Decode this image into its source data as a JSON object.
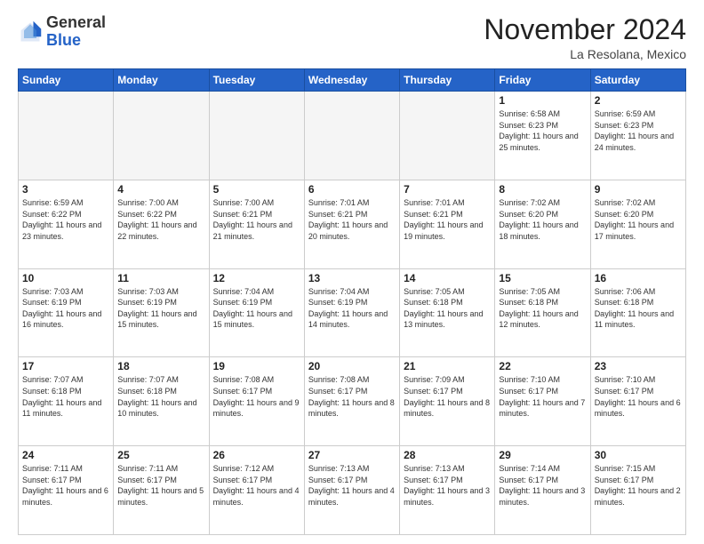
{
  "header": {
    "logo_general": "General",
    "logo_blue": "Blue",
    "month_title": "November 2024",
    "location": "La Resolana, Mexico"
  },
  "days_of_week": [
    "Sunday",
    "Monday",
    "Tuesday",
    "Wednesday",
    "Thursday",
    "Friday",
    "Saturday"
  ],
  "weeks": [
    [
      {
        "day": "",
        "info": ""
      },
      {
        "day": "",
        "info": ""
      },
      {
        "day": "",
        "info": ""
      },
      {
        "day": "",
        "info": ""
      },
      {
        "day": "",
        "info": ""
      },
      {
        "day": "1",
        "info": "Sunrise: 6:58 AM\nSunset: 6:23 PM\nDaylight: 11 hours and 25 minutes."
      },
      {
        "day": "2",
        "info": "Sunrise: 6:59 AM\nSunset: 6:23 PM\nDaylight: 11 hours and 24 minutes."
      }
    ],
    [
      {
        "day": "3",
        "info": "Sunrise: 6:59 AM\nSunset: 6:22 PM\nDaylight: 11 hours and 23 minutes."
      },
      {
        "day": "4",
        "info": "Sunrise: 7:00 AM\nSunset: 6:22 PM\nDaylight: 11 hours and 22 minutes."
      },
      {
        "day": "5",
        "info": "Sunrise: 7:00 AM\nSunset: 6:21 PM\nDaylight: 11 hours and 21 minutes."
      },
      {
        "day": "6",
        "info": "Sunrise: 7:01 AM\nSunset: 6:21 PM\nDaylight: 11 hours and 20 minutes."
      },
      {
        "day": "7",
        "info": "Sunrise: 7:01 AM\nSunset: 6:21 PM\nDaylight: 11 hours and 19 minutes."
      },
      {
        "day": "8",
        "info": "Sunrise: 7:02 AM\nSunset: 6:20 PM\nDaylight: 11 hours and 18 minutes."
      },
      {
        "day": "9",
        "info": "Sunrise: 7:02 AM\nSunset: 6:20 PM\nDaylight: 11 hours and 17 minutes."
      }
    ],
    [
      {
        "day": "10",
        "info": "Sunrise: 7:03 AM\nSunset: 6:19 PM\nDaylight: 11 hours and 16 minutes."
      },
      {
        "day": "11",
        "info": "Sunrise: 7:03 AM\nSunset: 6:19 PM\nDaylight: 11 hours and 15 minutes."
      },
      {
        "day": "12",
        "info": "Sunrise: 7:04 AM\nSunset: 6:19 PM\nDaylight: 11 hours and 15 minutes."
      },
      {
        "day": "13",
        "info": "Sunrise: 7:04 AM\nSunset: 6:19 PM\nDaylight: 11 hours and 14 minutes."
      },
      {
        "day": "14",
        "info": "Sunrise: 7:05 AM\nSunset: 6:18 PM\nDaylight: 11 hours and 13 minutes."
      },
      {
        "day": "15",
        "info": "Sunrise: 7:05 AM\nSunset: 6:18 PM\nDaylight: 11 hours and 12 minutes."
      },
      {
        "day": "16",
        "info": "Sunrise: 7:06 AM\nSunset: 6:18 PM\nDaylight: 11 hours and 11 minutes."
      }
    ],
    [
      {
        "day": "17",
        "info": "Sunrise: 7:07 AM\nSunset: 6:18 PM\nDaylight: 11 hours and 11 minutes."
      },
      {
        "day": "18",
        "info": "Sunrise: 7:07 AM\nSunset: 6:18 PM\nDaylight: 11 hours and 10 minutes."
      },
      {
        "day": "19",
        "info": "Sunrise: 7:08 AM\nSunset: 6:17 PM\nDaylight: 11 hours and 9 minutes."
      },
      {
        "day": "20",
        "info": "Sunrise: 7:08 AM\nSunset: 6:17 PM\nDaylight: 11 hours and 8 minutes."
      },
      {
        "day": "21",
        "info": "Sunrise: 7:09 AM\nSunset: 6:17 PM\nDaylight: 11 hours and 8 minutes."
      },
      {
        "day": "22",
        "info": "Sunrise: 7:10 AM\nSunset: 6:17 PM\nDaylight: 11 hours and 7 minutes."
      },
      {
        "day": "23",
        "info": "Sunrise: 7:10 AM\nSunset: 6:17 PM\nDaylight: 11 hours and 6 minutes."
      }
    ],
    [
      {
        "day": "24",
        "info": "Sunrise: 7:11 AM\nSunset: 6:17 PM\nDaylight: 11 hours and 6 minutes."
      },
      {
        "day": "25",
        "info": "Sunrise: 7:11 AM\nSunset: 6:17 PM\nDaylight: 11 hours and 5 minutes."
      },
      {
        "day": "26",
        "info": "Sunrise: 7:12 AM\nSunset: 6:17 PM\nDaylight: 11 hours and 4 minutes."
      },
      {
        "day": "27",
        "info": "Sunrise: 7:13 AM\nSunset: 6:17 PM\nDaylight: 11 hours and 4 minutes."
      },
      {
        "day": "28",
        "info": "Sunrise: 7:13 AM\nSunset: 6:17 PM\nDaylight: 11 hours and 3 minutes."
      },
      {
        "day": "29",
        "info": "Sunrise: 7:14 AM\nSunset: 6:17 PM\nDaylight: 11 hours and 3 minutes."
      },
      {
        "day": "30",
        "info": "Sunrise: 7:15 AM\nSunset: 6:17 PM\nDaylight: 11 hours and 2 minutes."
      }
    ]
  ]
}
